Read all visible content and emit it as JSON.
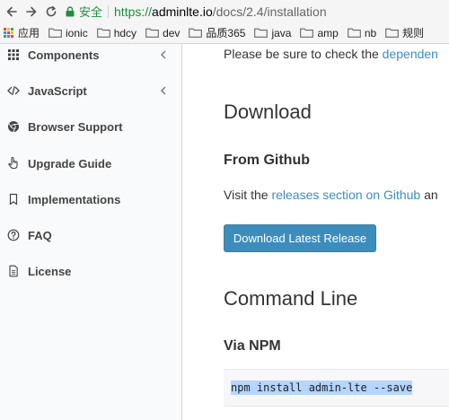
{
  "browser": {
    "secure_label": "安全",
    "url_scheme": "https://",
    "url_host": "adminlte.io",
    "url_path": "/docs/2.4/installation"
  },
  "bookmarks": {
    "apps_label": "应用",
    "folders": [
      "ionic",
      "hdcy",
      "dev",
      "品质365",
      "java",
      "amp",
      "nb",
      "规则"
    ]
  },
  "sidebar": {
    "items": [
      {
        "label": "Components",
        "icon": "grid-icon",
        "has_chevron": true
      },
      {
        "label": "JavaScript",
        "icon": "code-icon",
        "has_chevron": true
      },
      {
        "label": "Browser Support",
        "icon": "chrome-icon",
        "has_chevron": false
      },
      {
        "label": "Upgrade Guide",
        "icon": "hand-pointer-icon",
        "has_chevron": false
      },
      {
        "label": "Implementations",
        "icon": "bookmark-icon",
        "has_chevron": false
      },
      {
        "label": "FAQ",
        "icon": "question-circle-icon",
        "has_chevron": false
      },
      {
        "label": "License",
        "icon": "file-icon",
        "has_chevron": false
      }
    ]
  },
  "main": {
    "intro_text": "Please be sure to check the ",
    "intro_link": "dependen",
    "download_heading": "Download",
    "github_heading": "From Github",
    "visit_text": "Visit the ",
    "releases_link": "releases section on Github",
    "visit_tail": " an",
    "download_button": "Download Latest Release",
    "cli_heading": "Command Line",
    "npm_heading": "Via NPM",
    "npm_command": "npm install admin-lte --save"
  },
  "colors": {
    "accent": "#3c8dbc",
    "secure_green": "#1e8e3e",
    "sidebar_bg": "#f9fafc"
  }
}
